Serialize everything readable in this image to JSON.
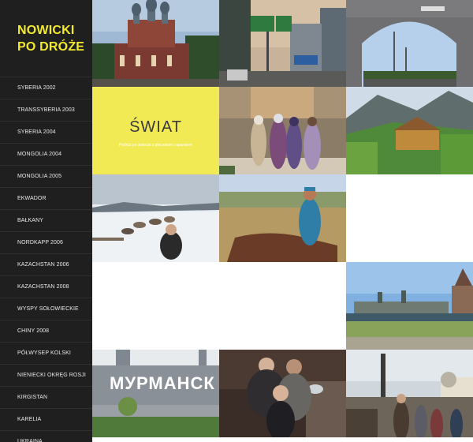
{
  "site": {
    "title": "NOWICKI PO DRÓŻE"
  },
  "nav": {
    "items": [
      "SYBERIA 2002",
      "TRANSSYBERIA 2003",
      "SYBERIA 2004",
      "MONGOLIA 2004",
      "MONGOLIA 2005",
      "EKWADOR",
      "BAŁKANY",
      "NORDKAPP 2006",
      "KAZACHSTAN 2006",
      "KAZACHSTAN 2008",
      "WYSPY SOŁOWIECKIE",
      "CHINY 2008",
      "PÓŁWYSEP KOLSKI",
      "NIENIECKI OKRĘG ROSJI",
      "KIRGISTAN",
      "KARELIA",
      "UKRAINA"
    ]
  },
  "featured": {
    "title": "ŚWIAT",
    "subtitle": "Podróż po świecie z plecakiem i aparatem"
  },
  "photos": {
    "church": "church photo",
    "road": "road photo",
    "gate": "city gate photo",
    "market": "market photo",
    "valley": "mountain valley photo",
    "sled": "dog sled photo",
    "rider": "horse rider photo",
    "monastery": "monastery photo",
    "murmansk_sign": "МУРМАНСК",
    "people": "people photo",
    "street": "street photo"
  },
  "colors": {
    "accent": "#f3ea2e",
    "sidebar": "#1f1f1f",
    "featured_bg": "#f2ea55"
  }
}
